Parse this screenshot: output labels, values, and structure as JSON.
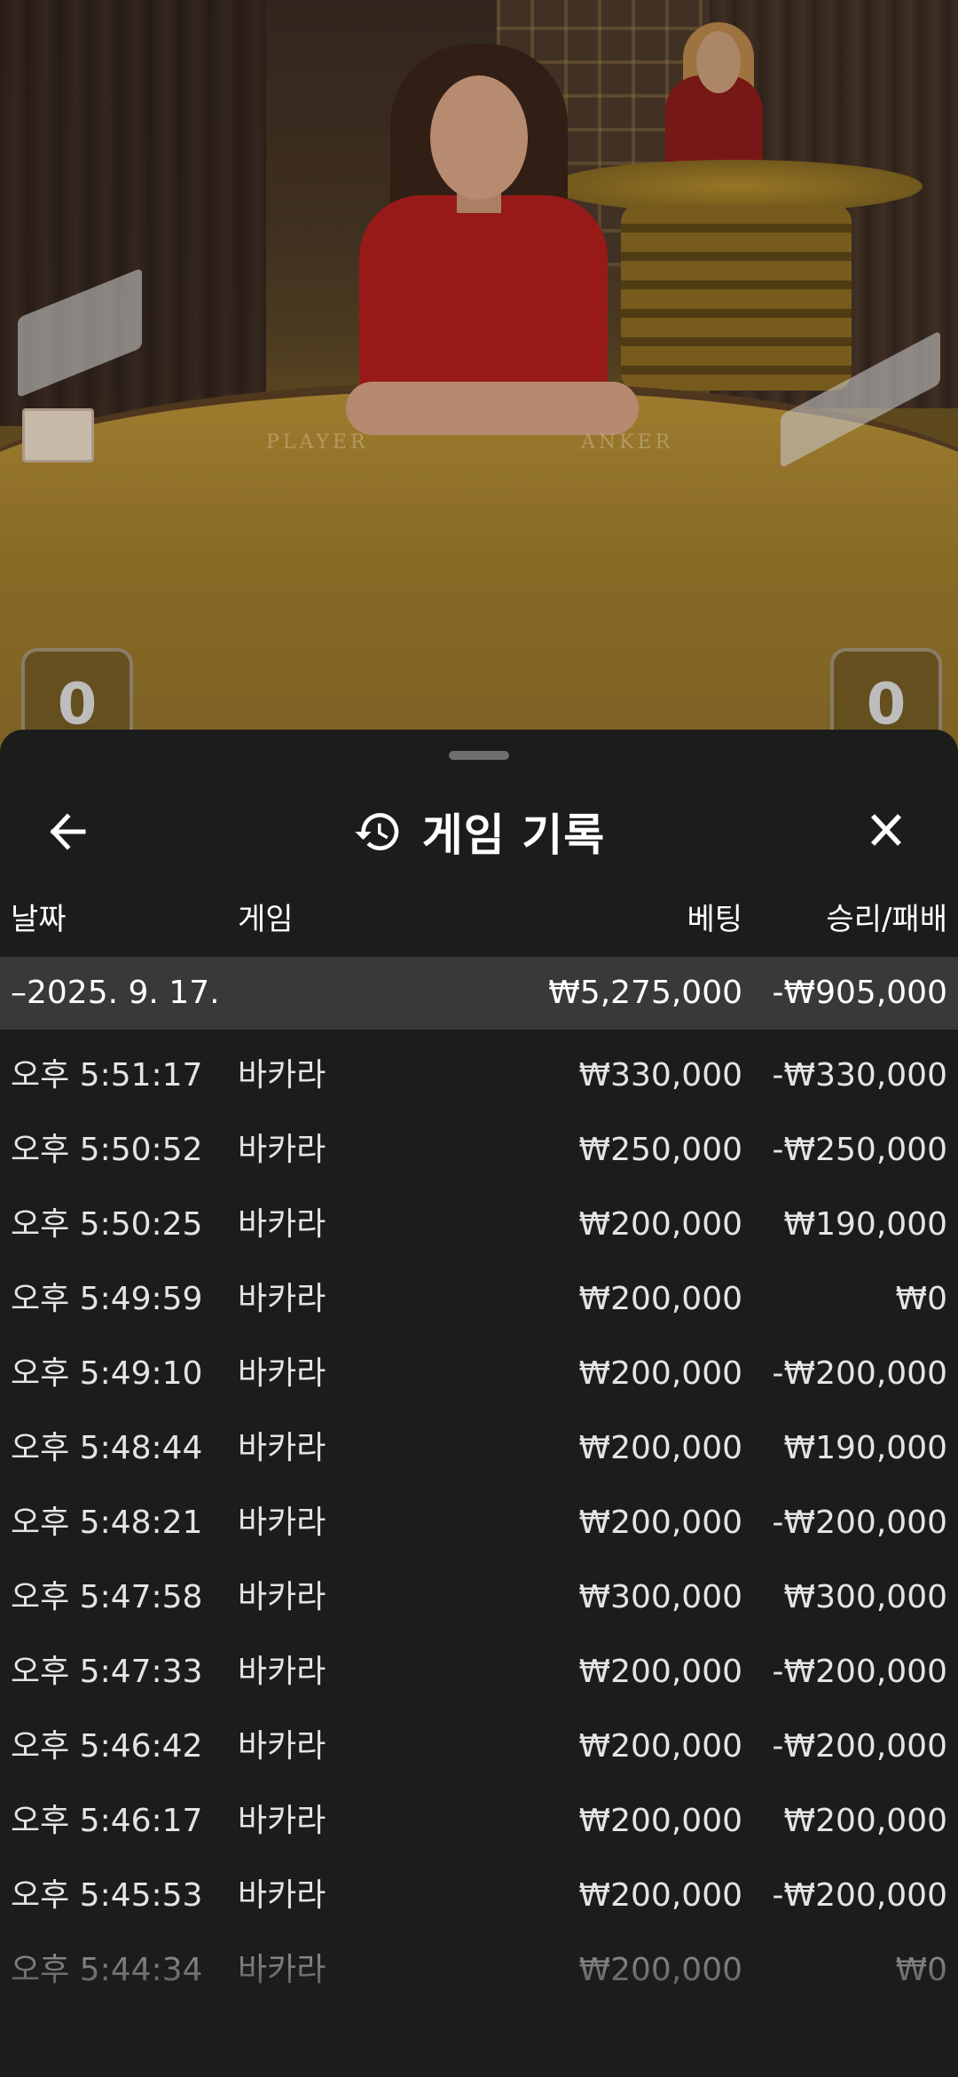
{
  "video": {
    "felt_player_label": "PLAYER",
    "felt_banker_label": "ANKER",
    "player_score": "0",
    "banker_score": "0"
  },
  "header": {
    "title": "게임 기록",
    "back_icon": "arrow-left-icon",
    "history_icon": "history-icon",
    "close_icon": "close-icon"
  },
  "columns": {
    "date": "날짜",
    "game": "게임",
    "bet": "베팅",
    "result": "승리/패배"
  },
  "summary": {
    "date": "–2025. 9. 17.",
    "bet": "₩5,275,000",
    "result": "-₩905,000"
  },
  "rows": [
    {
      "time": "오후 5:51:17",
      "game": "바카라",
      "bet": "₩330,000",
      "result": "-₩330,000"
    },
    {
      "time": "오후 5:50:52",
      "game": "바카라",
      "bet": "₩250,000",
      "result": "-₩250,000"
    },
    {
      "time": "오후 5:50:25",
      "game": "바카라",
      "bet": "₩200,000",
      "result": "₩190,000"
    },
    {
      "time": "오후 5:49:59",
      "game": "바카라",
      "bet": "₩200,000",
      "result": "₩0"
    },
    {
      "time": "오후 5:49:10",
      "game": "바카라",
      "bet": "₩200,000",
      "result": "-₩200,000"
    },
    {
      "time": "오후 5:48:44",
      "game": "바카라",
      "bet": "₩200,000",
      "result": "₩190,000"
    },
    {
      "time": "오후 5:48:21",
      "game": "바카라",
      "bet": "₩200,000",
      "result": "-₩200,000"
    },
    {
      "time": "오후 5:47:58",
      "game": "바카라",
      "bet": "₩300,000",
      "result": "₩300,000"
    },
    {
      "time": "오후 5:47:33",
      "game": "바카라",
      "bet": "₩200,000",
      "result": "-₩200,000"
    },
    {
      "time": "오후 5:46:42",
      "game": "바카라",
      "bet": "₩200,000",
      "result": "-₩200,000"
    },
    {
      "time": "오후 5:46:17",
      "game": "바카라",
      "bet": "₩200,000",
      "result": "₩200,000"
    },
    {
      "time": "오후 5:45:53",
      "game": "바카라",
      "bet": "₩200,000",
      "result": "-₩200,000"
    },
    {
      "time": "오후 5:44:34",
      "game": "바카라",
      "bet": "₩200,000",
      "result": "₩0"
    }
  ]
}
